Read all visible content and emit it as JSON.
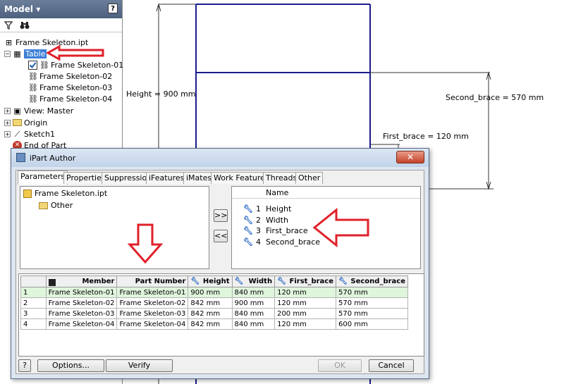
{
  "model_panel": {
    "title": "Model ▾",
    "help": "?",
    "toolbar": {
      "filter_icon": "filter-icon",
      "find_icon": "binoculars-icon"
    },
    "tree": {
      "root": "Frame Skeleton.ipt",
      "table": "Table",
      "members": [
        "Frame Skeleton-01",
        "Frame Skeleton-02",
        "Frame Skeleton-03",
        "Frame Skeleton-04"
      ],
      "view": "View: Master",
      "origin": "Origin",
      "sketch": "Sketch1",
      "end": "End of Part"
    }
  },
  "drawing": {
    "height_dim": "Height = 900 mm",
    "second_brace_dim": "Second_brace = 570 mm",
    "first_brace_dim": "First_brace = 120 mm",
    "line_color": "#1a1a8c",
    "arrow_color": "#e0202a"
  },
  "dialog": {
    "title": "iPart Author",
    "close": "✕",
    "tabs": [
      "Parameters",
      "Properties",
      "Suppression",
      "iFeatures",
      "iMates",
      "Work Features",
      "Threads",
      "Other"
    ],
    "left_tree": {
      "root": "Frame Skeleton.ipt",
      "child": "Other"
    },
    "move_right": ">>",
    "move_left": "<<",
    "name_header": "Name",
    "parameters": [
      {
        "num": "1",
        "name": "Height"
      },
      {
        "num": "2",
        "name": "Width"
      },
      {
        "num": "3",
        "name": "First_brace"
      },
      {
        "num": "4",
        "name": "Second_brace"
      }
    ],
    "table": {
      "headers": [
        "",
        "Member",
        "Part Number",
        "Height",
        "Width",
        "First_brace",
        "Second_brace"
      ],
      "rows": [
        {
          "n": "1",
          "member": "Frame Skeleton-01",
          "part": "Frame Skeleton-01",
          "height": "900 mm",
          "width": "840 mm",
          "first": "120 mm",
          "second": "570 mm"
        },
        {
          "n": "2",
          "member": "Frame Skeleton-02",
          "part": "Frame Skeleton-02",
          "height": "842 mm",
          "width": "900 mm",
          "first": "120 mm",
          "second": "570 mm"
        },
        {
          "n": "3",
          "member": "Frame Skeleton-03",
          "part": "Frame Skeleton-03",
          "height": "842 mm",
          "width": "840 mm",
          "first": "200 mm",
          "second": "570 mm"
        },
        {
          "n": "4",
          "member": "Frame Skeleton-04",
          "part": "Frame Skeleton-04",
          "height": "842 mm",
          "width": "840 mm",
          "first": "120 mm",
          "second": "600 mm"
        }
      ]
    },
    "buttons": {
      "help": "?",
      "options": "Options...",
      "verify": "Verify",
      "ok": "OK",
      "cancel": "Cancel"
    }
  }
}
